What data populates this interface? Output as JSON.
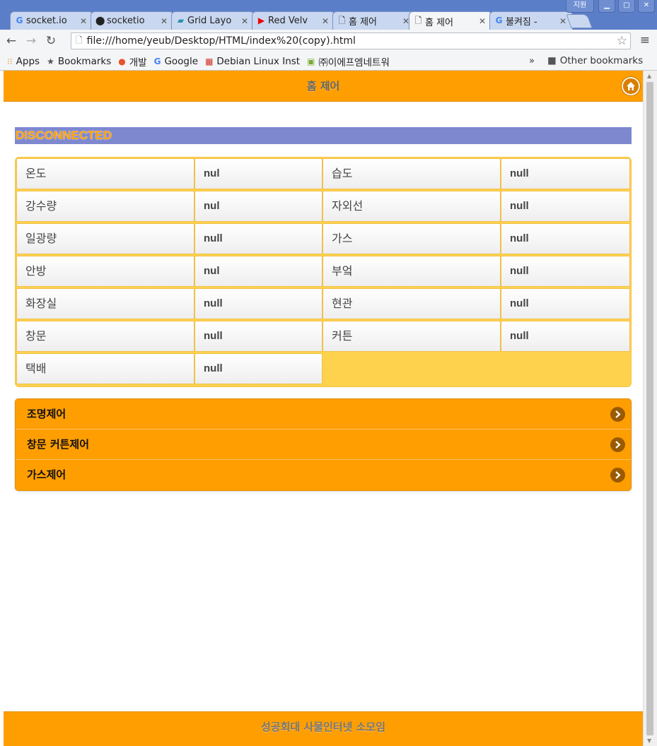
{
  "browser": {
    "tabs": [
      {
        "title": "socket.io",
        "favicon": "google-icon",
        "active": false
      },
      {
        "title": "socketio",
        "favicon": "github-icon",
        "active": false
      },
      {
        "title": "Grid Layo",
        "favicon": "grid-icon",
        "active": false
      },
      {
        "title": "Red Velv",
        "favicon": "youtube-icon",
        "active": false
      },
      {
        "title": "홈 제어",
        "favicon": "page-icon",
        "active": false
      },
      {
        "title": "홈 제어",
        "favicon": "page-icon",
        "active": true
      },
      {
        "title": "불켜짐 -",
        "favicon": "google-icon",
        "active": false
      }
    ],
    "window_badge": "지원",
    "url": "file:///home/yeub/Desktop/HTML/index%20(copy).html",
    "bookmarks": [
      {
        "label": "Apps",
        "icon": "apps-icon"
      },
      {
        "label": "Bookmarks",
        "icon": "star-icon"
      },
      {
        "label": "개발",
        "icon": "dev-icon"
      },
      {
        "label": "Google",
        "icon": "google-icon"
      },
      {
        "label": "Debian Linux Inst",
        "icon": "debian-icon"
      },
      {
        "label": "㈜이에프엠네트워",
        "icon": "efm-icon"
      }
    ],
    "bookmarks_more": "»",
    "other_bookmarks": "Other bookmarks"
  },
  "page": {
    "header_title": "홈 제어",
    "status": "DISCONNECTED",
    "sensors": [
      {
        "label": "온도",
        "value": "nul"
      },
      {
        "label": "습도",
        "value": "null"
      },
      {
        "label": "강수량",
        "value": "nul"
      },
      {
        "label": "자외선",
        "value": "null"
      },
      {
        "label": "일광량",
        "value": "null"
      },
      {
        "label": "가스",
        "value": "null"
      },
      {
        "label": "안방",
        "value": "nul"
      },
      {
        "label": "부엌",
        "value": "null"
      },
      {
        "label": "화장실",
        "value": "null"
      },
      {
        "label": "현관",
        "value": "null"
      },
      {
        "label": "창문",
        "value": "null"
      },
      {
        "label": "커튼",
        "value": "null"
      },
      {
        "label": "택배",
        "value": "null"
      }
    ],
    "menu": [
      {
        "label": "조명제어"
      },
      {
        "label": "창문 커튼제어"
      },
      {
        "label": "가스제어"
      }
    ],
    "footer": "성공회대 사물인터넷 소모임"
  },
  "colors": {
    "accent": "#ff9e00",
    "status_bar": "#7e88cf",
    "grid_bg": "#ffd24d"
  }
}
